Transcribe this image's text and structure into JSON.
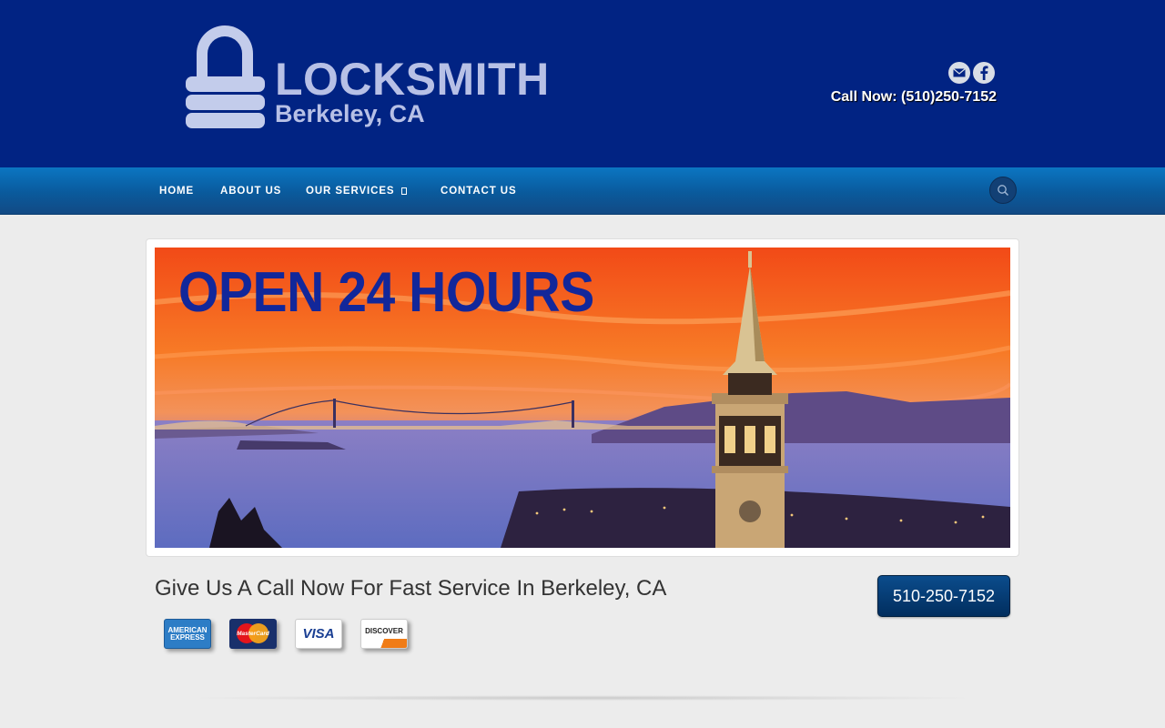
{
  "header": {
    "logo": {
      "title": "LOCKSMITH",
      "subtitle": "Berkeley, CA"
    },
    "social": [
      {
        "icon": "email-icon"
      },
      {
        "icon": "facebook-icon"
      }
    ],
    "call_now": "Call Now: (510)250-7152"
  },
  "nav": {
    "items": [
      {
        "label": "HOME"
      },
      {
        "label": "ABOUT US"
      },
      {
        "label": "OUR SERVICES"
      },
      {
        "label": "CONTACT US"
      }
    ],
    "search_icon": "search-icon"
  },
  "banner": {
    "headline": "OPEN 24 HOURS"
  },
  "cta": {
    "text": "Give Us A Call Now For Fast Service In Berkeley, CA",
    "phone_button": "510-250-7152"
  },
  "payment_cards": {
    "amex": "AMERICAN EXPRESS",
    "mastercard": "MasterCard",
    "visa": "VISA",
    "discover": "DISCOVER"
  },
  "colors": {
    "header_bg": "#012383",
    "nav_bg": "#0a5a9c",
    "headline": "#12279a",
    "button_bg": "#0b4c8c"
  }
}
